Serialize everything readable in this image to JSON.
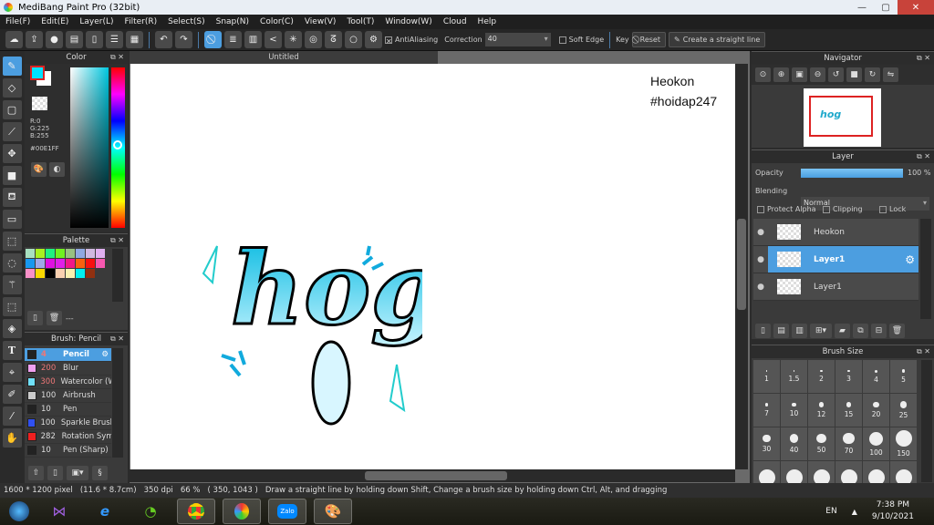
{
  "app": {
    "title": "MediBang Paint Pro (32bit)",
    "window_controls": [
      "—",
      "▢",
      "✕"
    ]
  },
  "menu": [
    "File(F)",
    "Edit(E)",
    "Layer(L)",
    "Filter(R)",
    "Select(S)",
    "Snap(N)",
    "Color(C)",
    "View(V)",
    "Tool(T)",
    "Window(W)",
    "Cloud",
    "Help"
  ],
  "toolbar": {
    "antialiasing": "AntiAliasing",
    "correction_label": "Correction",
    "correction_value": "40",
    "soft_edge": "Soft Edge",
    "key_label": "Key",
    "reset": "Reset",
    "straight_line": "Create a straight line"
  },
  "color_panel": {
    "title": "Color",
    "r": "R:0",
    "g": "G:225",
    "b": "B:255",
    "hex": "#00E1FF",
    "foreground": "#00E1FF",
    "background": "#FFFFFF"
  },
  "palette": {
    "title": "Palette",
    "colors": [
      "#a8e0c0",
      "#a8f020",
      "#20f080",
      "#70f020",
      "#98c080",
      "#90a8e0",
      "#d0b8e0",
      "#e0b0f0",
      "#1898f0",
      "#a0a8e8",
      "#e010e0",
      "#e020e8",
      "#f01888",
      "#f86010",
      "#f81010",
      "#f858b0",
      "#f890c8",
      "#f8d800",
      "#000000",
      "#f8d0b0",
      "#f8f0b0",
      "#00f0f0",
      "#903010"
    ],
    "set_label": "---"
  },
  "brush_panel": {
    "title": "Brush: Pencil",
    "brushes": [
      {
        "size": "4",
        "name": "Pencil",
        "color": "#222222"
      },
      {
        "size": "200",
        "name": "Blur",
        "color": "#f0a0f0"
      },
      {
        "size": "300",
        "name": "Watercolor (W",
        "color": "#70e0f8"
      },
      {
        "size": "100",
        "name": "Airbrush",
        "color": "#cccccc"
      },
      {
        "size": "10",
        "name": "Pen",
        "color": "#222222"
      },
      {
        "size": "100",
        "name": "Sparkle Brush",
        "color": "#3050f0"
      },
      {
        "size": "282",
        "name": "Rotation Sym",
        "color": "#f02020"
      },
      {
        "size": "10",
        "name": "Pen (Sharp)",
        "color": "#222222"
      }
    ]
  },
  "canvas": {
    "tab": "Untitled",
    "text_line1": "Heokon",
    "text_line2": "#hoidap247",
    "art_text": "hog"
  },
  "navigator": {
    "title": "Navigator"
  },
  "layer_panel": {
    "title": "Layer",
    "opacity_label": "Opacity",
    "opacity_value": "100 %",
    "opacity": 100,
    "blending_label": "Blending",
    "blending_value": "Normal",
    "protect_alpha": "Protect Alpha",
    "clipping": "Clipping",
    "lock": "Lock",
    "layers": [
      {
        "name": "Heokon",
        "selected": false
      },
      {
        "name": "Layer1",
        "selected": true
      },
      {
        "name": "Layer1",
        "selected": false
      }
    ]
  },
  "brush_size": {
    "title": "Brush Size",
    "sizes": [
      "1",
      "1.5",
      "2",
      "3",
      "4",
      "5",
      "7",
      "10",
      "12",
      "15",
      "20",
      "25",
      "30",
      "40",
      "50",
      "70",
      "100",
      "150"
    ]
  },
  "status": "1600 * 1200 pixel   (11.6 * 8.7cm)   350 dpi   66 %   ( 350, 1043 )   Draw a straight line by holding down Shift, Change a brush size by holding down Ctrl, Alt, and dragging",
  "taskbar": {
    "lang": "EN",
    "time": "7:38 PM",
    "date": "9/10/2021",
    "apps": [
      "start",
      "visual-studio",
      "internet-explorer",
      "coc-coc",
      "chrome",
      "medibang",
      "zalo",
      "paint"
    ]
  }
}
